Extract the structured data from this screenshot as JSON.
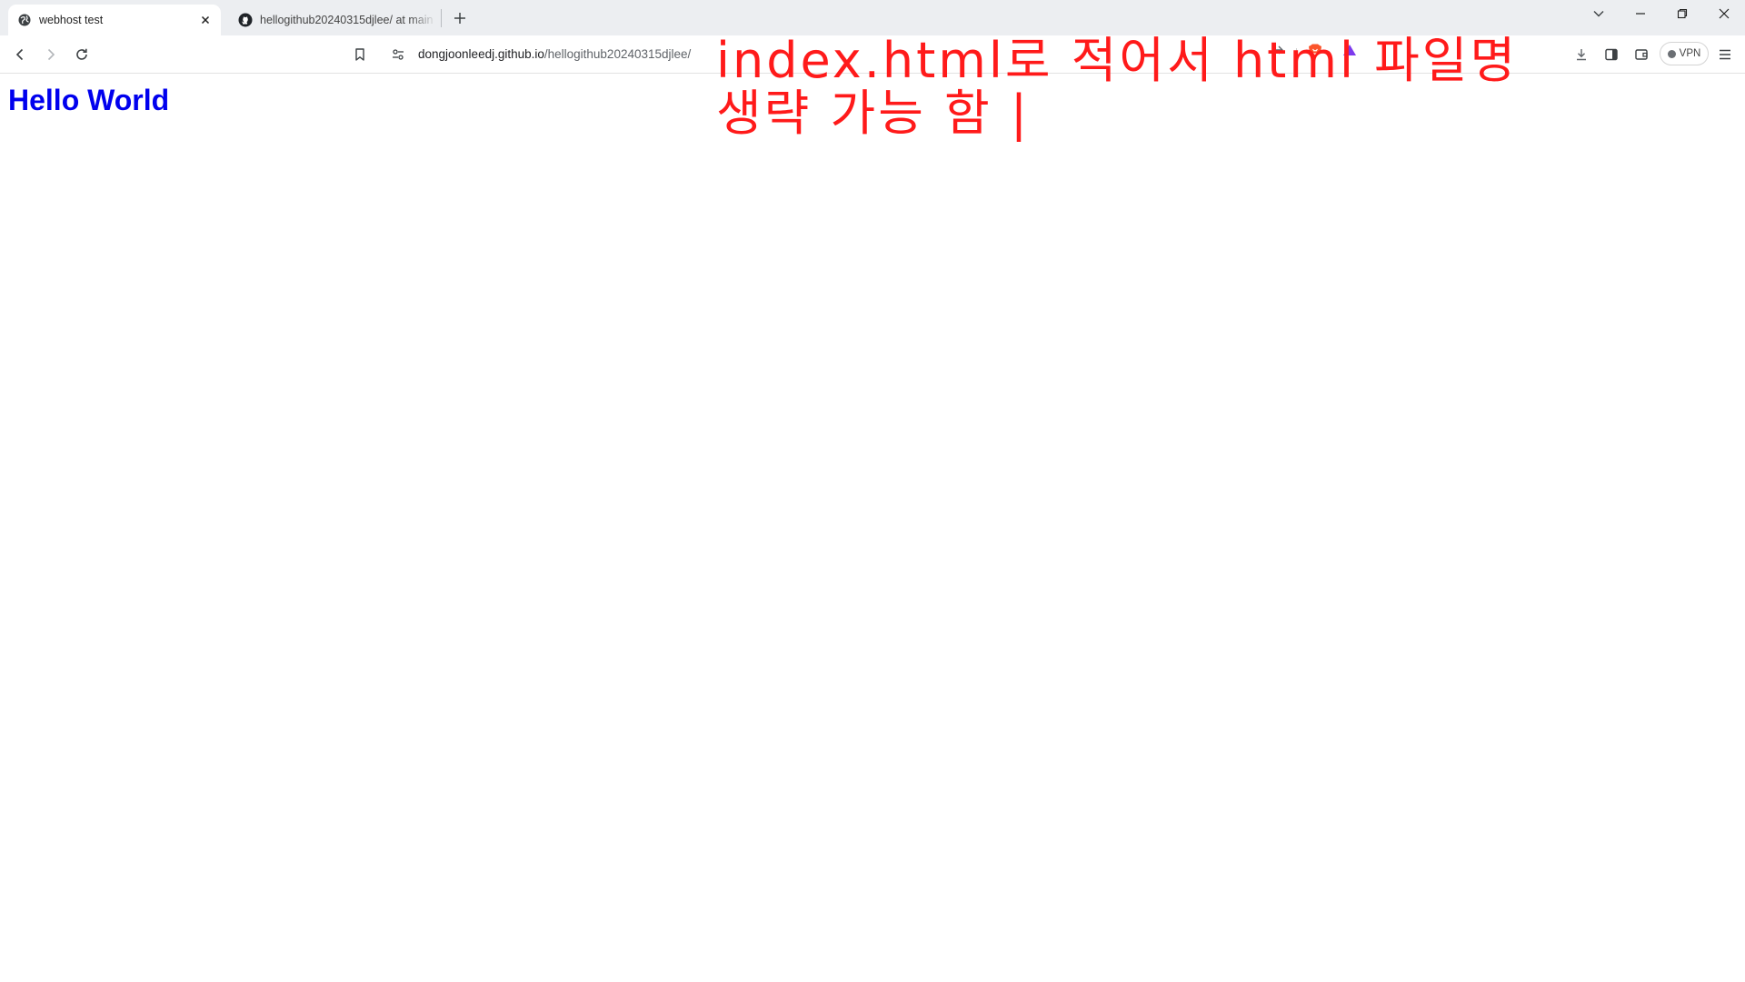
{
  "tabs": [
    {
      "title": "webhost test",
      "active": true,
      "favicon": "globe-icon"
    },
    {
      "title": "hellogithub20240315djlee/ at main",
      "active": false,
      "favicon": "github-icon"
    }
  ],
  "address_bar": {
    "host": "dongjoonleedj.github.io",
    "path": "/hellogithub20240315djlee/"
  },
  "toolbar": {
    "vpn_label": "VPN"
  },
  "page": {
    "heading": "Hello World",
    "heading_color": "#0000ee"
  },
  "annotation": {
    "line1": "index.html로 적어서 html 파일명",
    "line2": "생략 가능 함 |",
    "color": "#ff1a1a"
  }
}
